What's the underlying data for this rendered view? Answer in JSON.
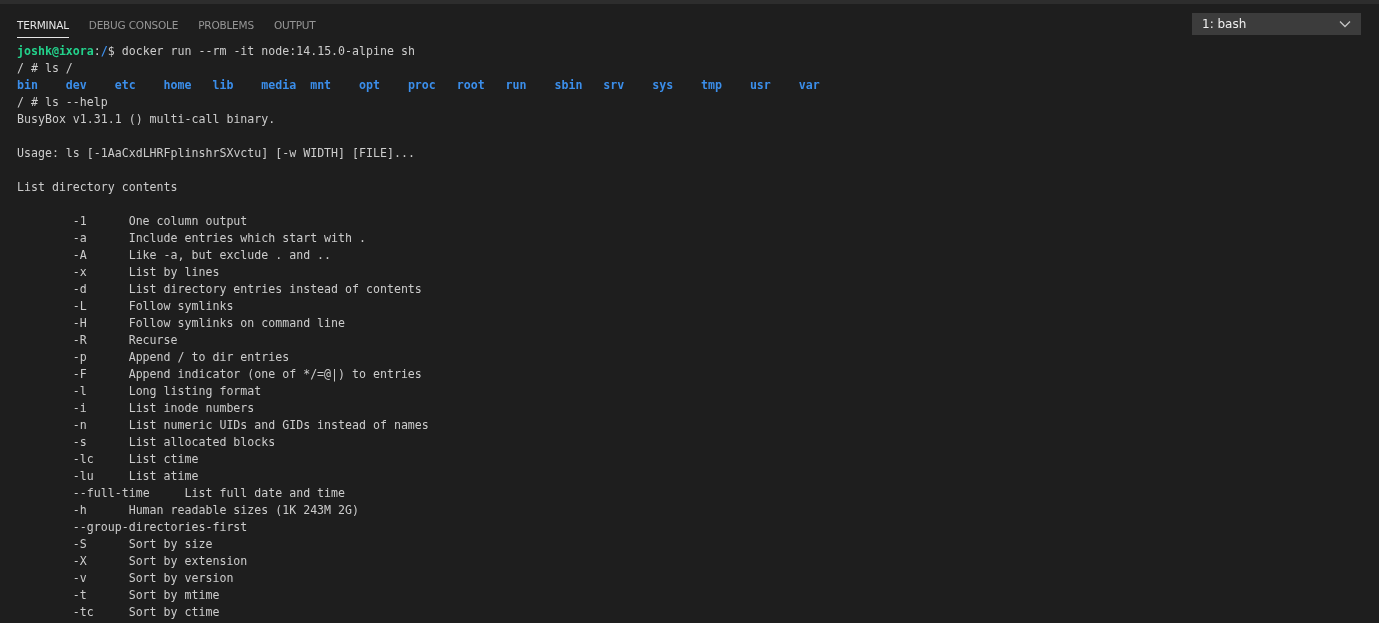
{
  "tabs": [
    {
      "label": "TERMINAL",
      "selected": true
    },
    {
      "label": "DEBUG CONSOLE",
      "selected": false
    },
    {
      "label": "PROBLEMS",
      "selected": false
    },
    {
      "label": "OUTPUT",
      "selected": false
    }
  ],
  "terminal_select": {
    "value": "1: bash"
  },
  "terminal_lines": [
    {
      "kind": "prompt",
      "user_host": "joshk@ixora",
      "separator": ":",
      "path": "/",
      "symbol": "$",
      "command": "docker run --rm -it node:14.15.0-alpine sh"
    },
    {
      "kind": "text",
      "text": "/ # ls /"
    },
    {
      "kind": "listing",
      "entries": [
        "bin",
        "dev",
        "etc",
        "home",
        "lib",
        "media",
        "mnt",
        "opt",
        "proc",
        "root",
        "run",
        "sbin",
        "srv",
        "sys",
        "tmp",
        "usr",
        "var"
      ]
    },
    {
      "kind": "text",
      "text": "/ # ls --help"
    },
    {
      "kind": "text",
      "text": "BusyBox v1.31.1 () multi-call binary."
    },
    {
      "kind": "blank"
    },
    {
      "kind": "text",
      "text": "Usage: ls [-1AaCxdLHRFplinshrSXvctu] [-w WIDTH] [FILE]..."
    },
    {
      "kind": "blank"
    },
    {
      "kind": "text",
      "text": "List directory contents"
    },
    {
      "kind": "blank"
    },
    {
      "kind": "option",
      "flag": "-1",
      "description": "One column output"
    },
    {
      "kind": "option",
      "flag": "-a",
      "description": "Include entries which start with ."
    },
    {
      "kind": "option",
      "flag": "-A",
      "description": "Like -a, but exclude . and .."
    },
    {
      "kind": "option",
      "flag": "-x",
      "description": "List by lines"
    },
    {
      "kind": "option",
      "flag": "-d",
      "description": "List directory entries instead of contents"
    },
    {
      "kind": "option",
      "flag": "-L",
      "description": "Follow symlinks"
    },
    {
      "kind": "option",
      "flag": "-H",
      "description": "Follow symlinks on command line"
    },
    {
      "kind": "option",
      "flag": "-R",
      "description": "Recurse"
    },
    {
      "kind": "option",
      "flag": "-p",
      "description": "Append / to dir entries"
    },
    {
      "kind": "option",
      "flag": "-F",
      "description": "Append indicator (one of */=@|) to entries"
    },
    {
      "kind": "option",
      "flag": "-l",
      "description": "Long listing format"
    },
    {
      "kind": "option",
      "flag": "-i",
      "description": "List inode numbers"
    },
    {
      "kind": "option",
      "flag": "-n",
      "description": "List numeric UIDs and GIDs instead of names"
    },
    {
      "kind": "option",
      "flag": "-s",
      "description": "List allocated blocks"
    },
    {
      "kind": "option",
      "flag": "-lc",
      "description": "List ctime"
    },
    {
      "kind": "option",
      "flag": "-lu",
      "description": "List atime"
    },
    {
      "kind": "option",
      "flag": "--full-time",
      "description": "List full date and time"
    },
    {
      "kind": "option",
      "flag": "-h",
      "description": "Human readable sizes (1K 243M 2G)"
    },
    {
      "kind": "option",
      "flag": "--group-directories-first"
    },
    {
      "kind": "option",
      "flag": "-S",
      "description": "Sort by size"
    },
    {
      "kind": "option",
      "flag": "-X",
      "description": "Sort by extension"
    },
    {
      "kind": "option",
      "flag": "-v",
      "description": "Sort by version"
    },
    {
      "kind": "option",
      "flag": "-t",
      "description": "Sort by mtime"
    },
    {
      "kind": "option",
      "flag": "-tc",
      "description": "Sort by ctime"
    }
  ]
}
